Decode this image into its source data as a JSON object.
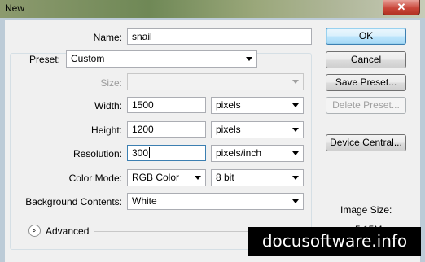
{
  "window": {
    "title": "New",
    "close_glyph": "✕"
  },
  "form": {
    "name": {
      "label": "Name:",
      "value": "snail"
    },
    "preset": {
      "label": "Preset:",
      "value": "Custom"
    },
    "size": {
      "label": "Size:",
      "value": ""
    },
    "width": {
      "label": "Width:",
      "value": "1500",
      "unit": "pixels"
    },
    "height": {
      "label": "Height:",
      "value": "1200",
      "unit": "pixels"
    },
    "resolution": {
      "label": "Resolution:",
      "value": "300",
      "unit": "pixels/inch"
    },
    "color_mode": {
      "label": "Color Mode:",
      "mode": "RGB Color",
      "depth": "8 bit"
    },
    "background": {
      "label": "Background Contents:",
      "value": "White"
    },
    "advanced": {
      "label": "Advanced",
      "expand_glyph": "»"
    }
  },
  "buttons": {
    "ok": "OK",
    "cancel": "Cancel",
    "save_preset": "Save Preset...",
    "delete_preset": "Delete Preset...",
    "device_central": "Device Central..."
  },
  "image_size": {
    "label": "Image Size:",
    "value": "5.15M"
  },
  "watermark": "docusoftware.info"
}
